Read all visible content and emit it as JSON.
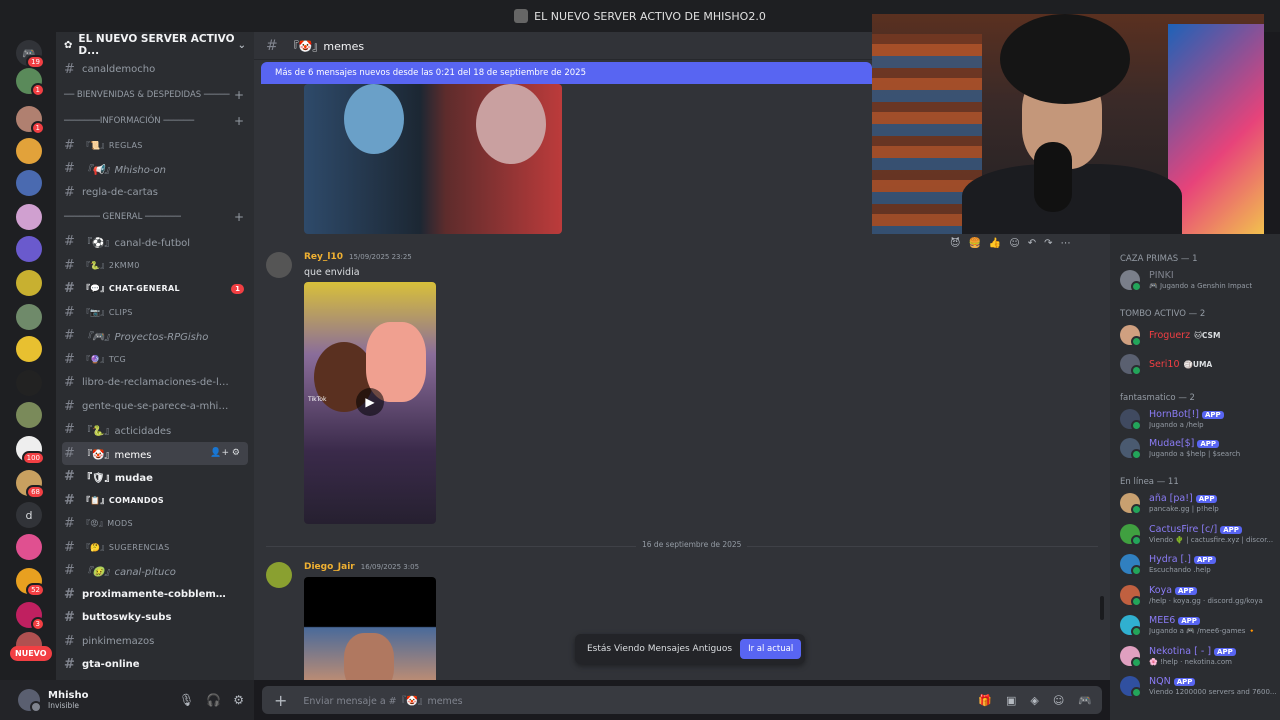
{
  "window_title": "EL NUEVO SERVER ACTIVO DE MHISHO2.0",
  "server": {
    "name": "EL NUEVO SERVER ACTIVO D...",
    "badges": [
      "19",
      "1",
      "1",
      "1",
      "100",
      "68",
      "52",
      "3"
    ],
    "letter_icon": "d",
    "nuevo_label": "NUEVO"
  },
  "channels": [
    {
      "type": "channel",
      "name": "canaldemocho",
      "style": ""
    },
    {
      "type": "category",
      "name": "── BIENVENIDAS & DESPEDIDAS ─────"
    },
    {
      "type": "category",
      "name": "───────INFORMACIÓN ──────"
    },
    {
      "type": "channel",
      "name": "『📜』REGLAS",
      "style": "small"
    },
    {
      "type": "channel",
      "name": "『📢』Mhisho-on",
      "style": "ital"
    },
    {
      "type": "channel",
      "name": "regla-de-cartas",
      "style": ""
    },
    {
      "type": "category",
      "name": "─────── GENERAL ───────"
    },
    {
      "type": "channel",
      "name": "『⚽』canal-de-futbol",
      "style": ""
    },
    {
      "type": "channel",
      "name": "『🐍』2KMM0",
      "style": "small"
    },
    {
      "type": "channel",
      "name": "『💬』CHAT-GENERAL",
      "style": "bright small",
      "unread": "1"
    },
    {
      "type": "channel",
      "name": "『📷』CLIPS",
      "style": "small"
    },
    {
      "type": "channel",
      "name": "『🎮』Proyectos-RPGisho",
      "style": "ital"
    },
    {
      "type": "channel",
      "name": "『🔮』TCG",
      "style": "small"
    },
    {
      "type": "channel",
      "name": "libro-de-reclamaciones-de-lord...",
      "style": ""
    },
    {
      "type": "channel",
      "name": "gente-que-se-parece-a-mhisho...",
      "style": ""
    },
    {
      "type": "channel",
      "name": "『🐍』acticidades",
      "style": ""
    },
    {
      "type": "channel",
      "name": "『🤡』memes",
      "style": "active"
    },
    {
      "type": "channel",
      "name": "『🛡』mudae",
      "style": "bright"
    },
    {
      "type": "channel",
      "name": "『📋』COMANDOS",
      "style": "bright small"
    },
    {
      "type": "channel",
      "name": "『😡』MODS",
      "style": "small"
    },
    {
      "type": "channel",
      "name": "『🤔』SUGERENCIAS",
      "style": "small"
    },
    {
      "type": "channel",
      "name": "『🤢』canal-pituco",
      "style": "ital"
    },
    {
      "type": "channel",
      "name": "proximamente-cobblemon-🚧...",
      "style": "bright"
    },
    {
      "type": "channel",
      "name": "buttoswky-subs",
      "style": "bright"
    },
    {
      "type": "channel",
      "name": "pinkimemazos",
      "style": ""
    },
    {
      "type": "channel",
      "name": "gta-online",
      "style": "bright"
    }
  ],
  "user": {
    "name": "Mhisho",
    "status": "Invisible"
  },
  "chat": {
    "channel_name": "『🤡』memes",
    "new_messages_bar": "Más de 6 mensajes nuevos desde las 0:21 del 18 de septiembre de 2025",
    "messages": [
      {
        "author": "Rey_l10",
        "timestamp": "15/09/2025 23:25",
        "text": "que envidia",
        "author_color": "#f0b132"
      },
      {
        "author": "Diego_Jair",
        "timestamp": "16/09/2025 3:05",
        "text": "",
        "author_color": "#f0b132"
      }
    ],
    "date_divider": "16 de septiembre de 2025",
    "video_watermark": "TikTok",
    "old_messages_text": "Estás Viendo Mensajes Antiguos",
    "jump_button": "Ir al actual",
    "composer_placeholder": "Enviar mensaje a #『🤡』memes"
  },
  "members": {
    "groups": [
      {
        "title": "CAZA PRIMAS — 1",
        "members": [
          {
            "name": "PINKI",
            "status": "🎮 Jugando a Genshin Impact",
            "color": "#80848e",
            "tag": ""
          }
        ]
      },
      {
        "title": "TOMBO ACTIVO — 2",
        "members": [
          {
            "name": "Froguerz",
            "status": "",
            "color": "#f23f43",
            "tag": "🐱CSM"
          },
          {
            "name": "Seri10",
            "status": "",
            "color": "#f23f43",
            "tag": "🏐UMA"
          }
        ]
      },
      {
        "title": "fantasmatico — 2",
        "members": [
          {
            "name": "HornBot[!]",
            "status": "Jugando a /help",
            "color": "#8b7cf6",
            "tag": "APP"
          },
          {
            "name": "Mudae[$]",
            "status": "Jugando a $help | $search",
            "color": "#8b7cf6",
            "tag": "APP"
          }
        ]
      },
      {
        "title": "En línea — 11",
        "members": [
          {
            "name": "aña [pa!]",
            "status": "pancake.gg | p!help",
            "color": "#8b7cf6",
            "tag": "APP"
          },
          {
            "name": "CactusFire [c/]",
            "status": "Viendo 🌵 | cactusfire.xyz | discor...",
            "color": "#8b7cf6",
            "tag": "APP"
          },
          {
            "name": "Hydra [.]",
            "status": "Escuchando .help",
            "color": "#8b7cf6",
            "tag": "APP"
          },
          {
            "name": "Koya",
            "status": "/help · koya.gg · discord.gg/koya",
            "color": "#8b7cf6",
            "tag": "APP"
          },
          {
            "name": "MEE6",
            "status": "Jugando a 🎮 /mee6-games 🔸",
            "color": "#8b7cf6",
            "tag": "APP"
          },
          {
            "name": "Nekotina [ - ]",
            "status": "🌸 !help · nekotina.com",
            "color": "#8b7cf6",
            "tag": "APP"
          },
          {
            "name": "NQN",
            "status": "Viendo 1200000 servers and 7600...",
            "color": "#8b7cf6",
            "tag": "APP"
          }
        ]
      }
    ]
  },
  "colors": {
    "accent": "#5865f2",
    "danger": "#f23f43",
    "online": "#23a55a"
  }
}
